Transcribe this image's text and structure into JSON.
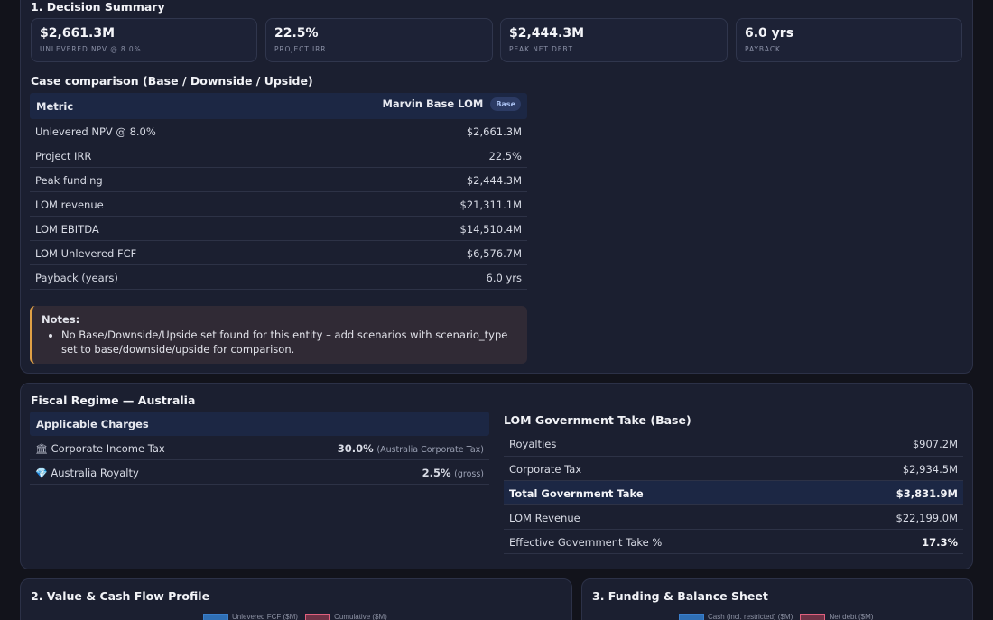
{
  "decision": {
    "title": "1. Decision Summary",
    "kpis": [
      {
        "value": "$2,661.3M",
        "label": "UNLEVERED NPV @ 8.0%"
      },
      {
        "value": "22.5%",
        "label": "PROJECT IRR"
      },
      {
        "value": "$2,444.3M",
        "label": "PEAK NET DEBT"
      },
      {
        "value": "6.0 yrs",
        "label": "PAYBACK"
      }
    ],
    "case_title": "Case comparison (Base / Downside / Upside)",
    "table": {
      "col_metric": "Metric",
      "col_case": "Marvin Base LOM",
      "badge": "Base",
      "rows": [
        {
          "metric": "Unlevered NPV @ 8.0%",
          "value": "$2,661.3M"
        },
        {
          "metric": "Project IRR",
          "value": "22.5%"
        },
        {
          "metric": "Peak funding",
          "value": "$2,444.3M"
        },
        {
          "metric": "LOM revenue",
          "value": "$21,311.1M"
        },
        {
          "metric": "LOM EBITDA",
          "value": "$14,510.4M"
        },
        {
          "metric": "LOM Unlevered FCF",
          "value": "$6,576.7M"
        },
        {
          "metric": "Payback (years)",
          "value": "6.0 yrs"
        }
      ]
    },
    "notes": {
      "title": "Notes:",
      "items": [
        "No Base/Downside/Upside set found for this entity – add scenarios with scenario_type set to base/downside/upside for comparison."
      ]
    }
  },
  "fiscal": {
    "title": "Fiscal Regime — Australia",
    "charges_header": "Applicable Charges",
    "charges": [
      {
        "icon": "bank-icon",
        "name": "Corporate Income Tax",
        "rate": "30.0%",
        "note": "(Australia Corporate Tax)"
      },
      {
        "icon": "gem-icon",
        "name": "Australia Royalty",
        "rate": "2.5%",
        "note": "(gross)"
      }
    ],
    "gov_title": "LOM Government Take (Base)",
    "gov_rows": [
      {
        "label": "Royalties",
        "value": "$907.2M",
        "highlight": false,
        "bold": false
      },
      {
        "label": "Corporate Tax",
        "value": "$2,934.5M",
        "highlight": false,
        "bold": false
      },
      {
        "label": "Total Government Take",
        "value": "$3,831.9M",
        "highlight": true,
        "bold": true
      },
      {
        "label": "LOM Revenue",
        "value": "$22,199.0M",
        "highlight": false,
        "bold": false
      },
      {
        "label": "Effective Government Take %",
        "value": "17.3%",
        "highlight": false,
        "bold": true
      }
    ]
  },
  "value_cf": {
    "title": "2. Value & Cash Flow Profile",
    "legend": [
      "Unlevered FCF ($M)",
      "Cumulative ($M)"
    ]
  },
  "funding": {
    "title": "3. Funding & Balance Sheet",
    "legend": [
      "Cash (incl. restricted) ($M)",
      "Net debt ($M)"
    ]
  },
  "colors": {
    "accent_blue": "#2f6fb5",
    "accent_pink": "#e0607e",
    "note_border": "#e0a045"
  }
}
